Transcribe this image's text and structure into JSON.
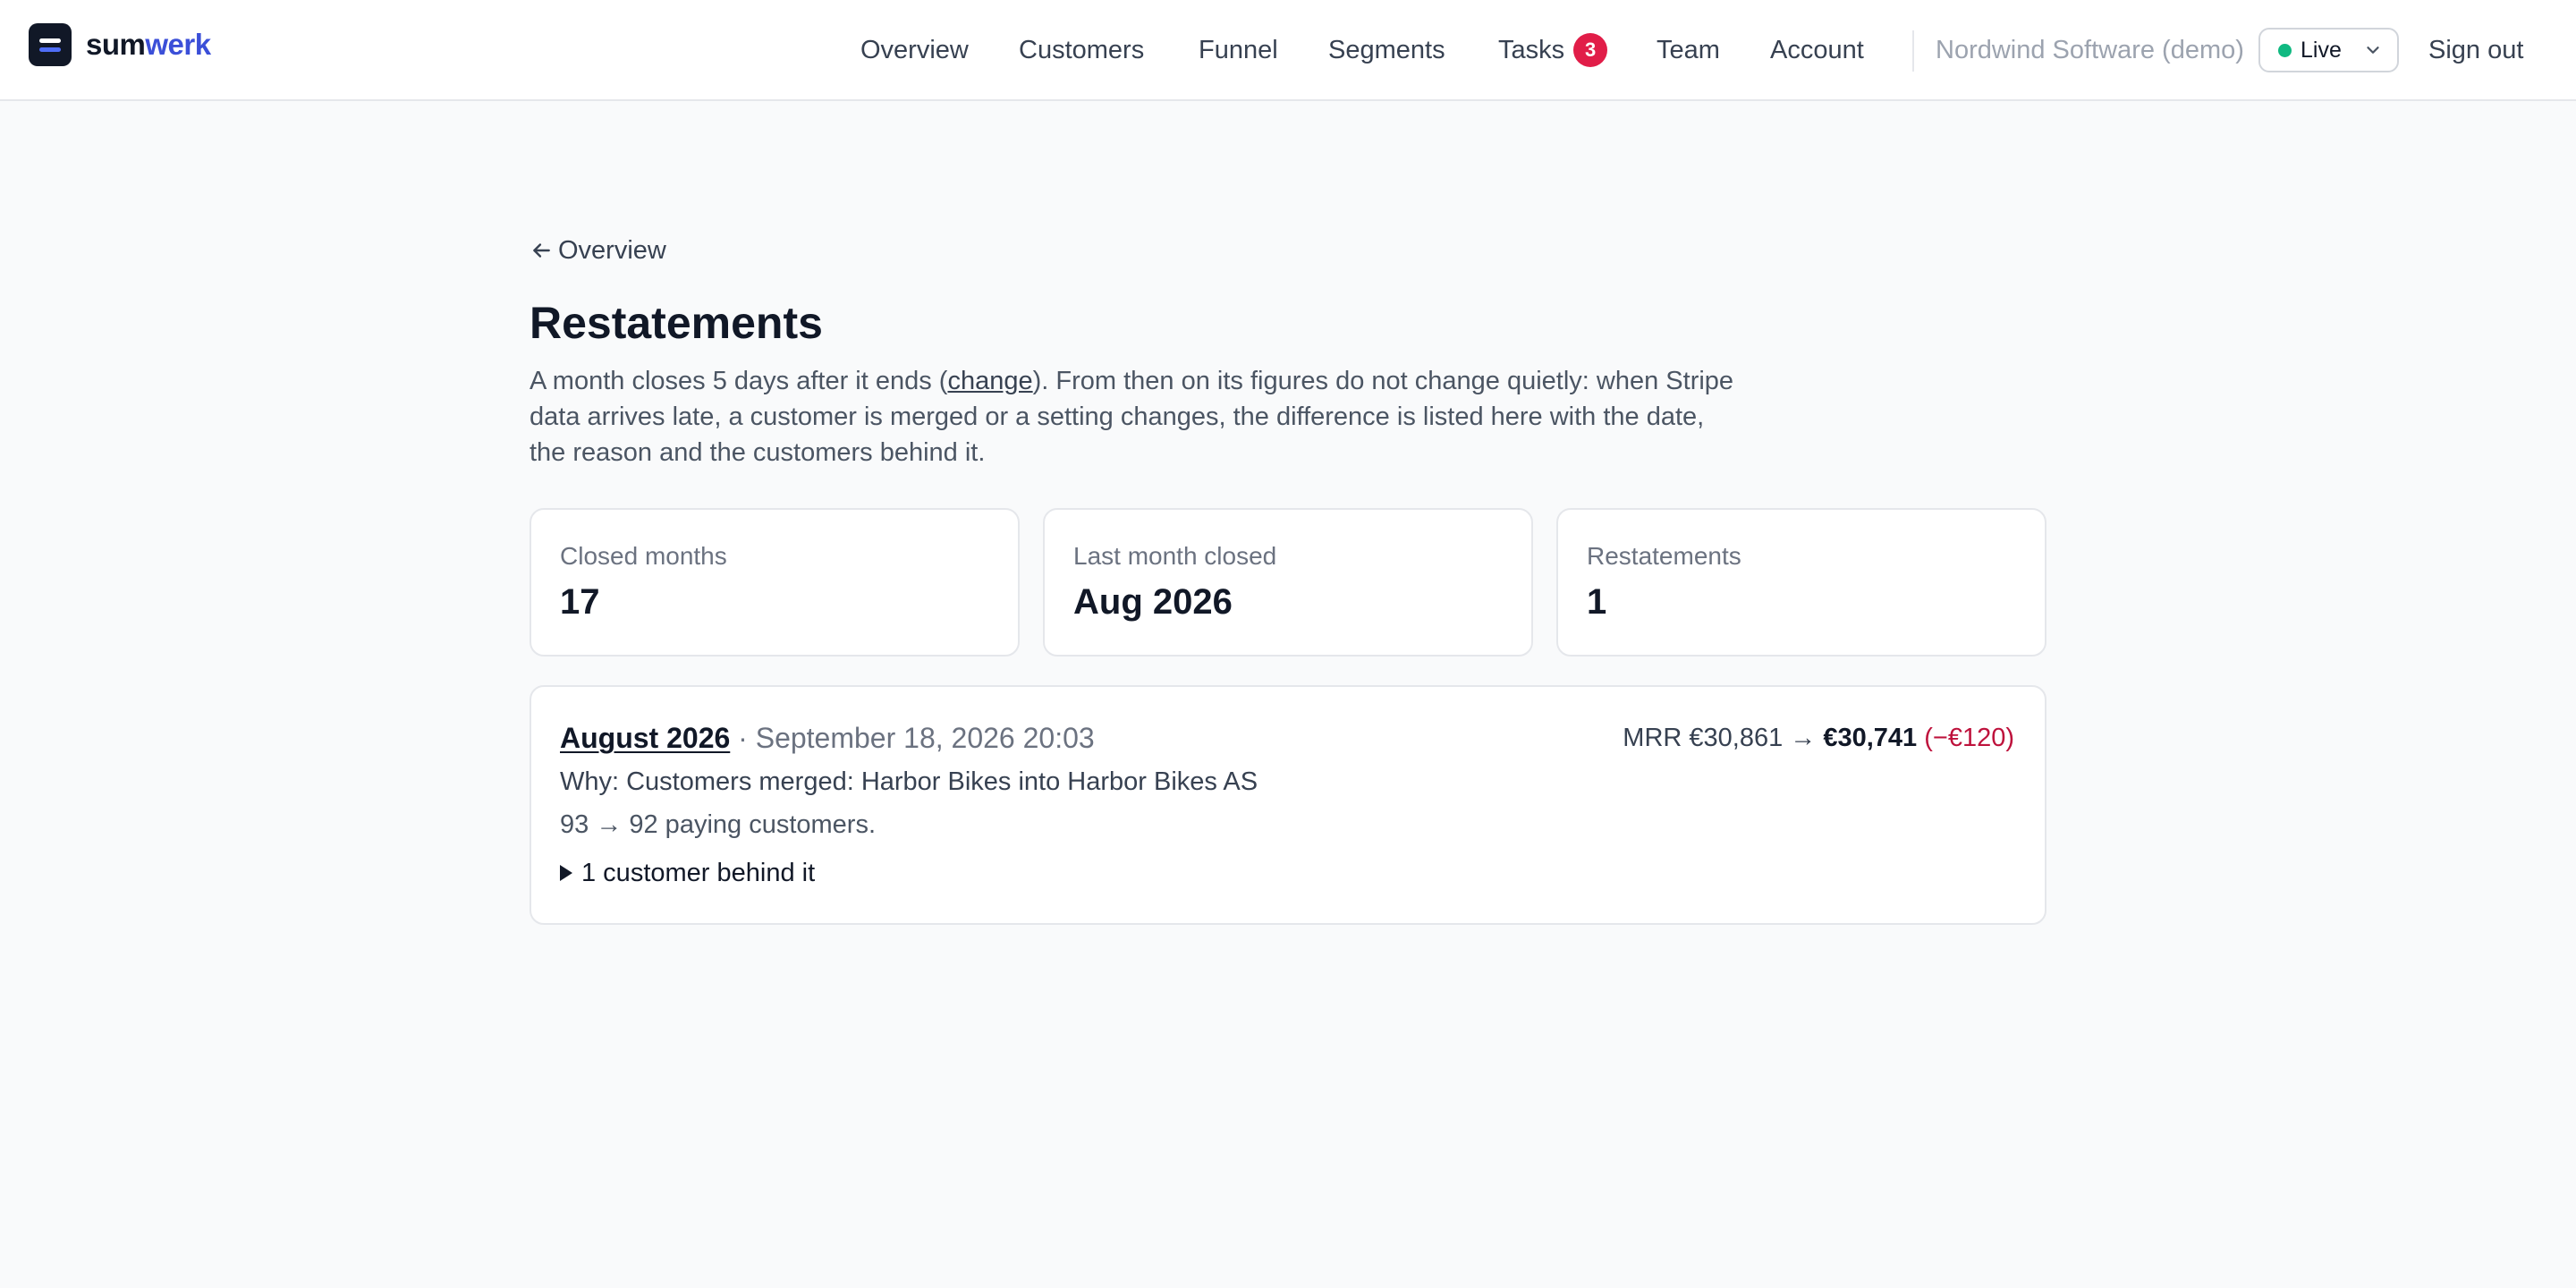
{
  "brand": {
    "part1": "sum",
    "part2": "werk"
  },
  "nav": {
    "items": [
      {
        "label": "Overview"
      },
      {
        "label": "Customers"
      },
      {
        "label": "Funnel"
      },
      {
        "label": "Segments"
      },
      {
        "label": "Tasks",
        "badge": "3"
      },
      {
        "label": "Team"
      },
      {
        "label": "Account"
      }
    ],
    "workspace": "Nordwind Software (demo)",
    "environment": {
      "label": "Live",
      "status_color": "#10b981"
    },
    "signout": "Sign out"
  },
  "page": {
    "back_label": "Overview",
    "title": "Restatements",
    "intro_before": "A month closes 5 days after it ends (",
    "intro_link": "change",
    "intro_after": "). From then on its figures do not change quietly: when Stripe data arrives late, a customer is merged or a setting changes, the difference is listed here with the date, the reason and the customers behind it."
  },
  "stats": [
    {
      "label": "Closed months",
      "value": "17"
    },
    {
      "label": "Last month closed",
      "value": "Aug 2026"
    },
    {
      "label": "Restatements",
      "value": "1"
    }
  ],
  "restatements": [
    {
      "month": "August 2026",
      "separator": "·",
      "date": "September 18, 2026 20:03",
      "mrr_prefix": "MRR",
      "mrr_from": "€30,861",
      "mrr_arrow": "→",
      "mrr_to": "€30,741",
      "mrr_delta": "(−€120)",
      "why": "Why: Customers merged: Harbor Bikes into Harbor Bikes AS",
      "customers_change": "93 → 92 paying customers.",
      "toggle_label": "1 customer behind it"
    }
  ],
  "colors": {
    "accent": "#3b4fd8",
    "negative": "#be123c",
    "badge": "#e11d48"
  }
}
